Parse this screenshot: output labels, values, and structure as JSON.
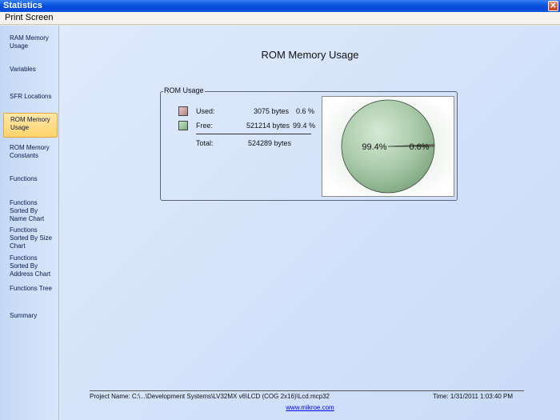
{
  "window": {
    "title": "Statistics"
  },
  "menu": {
    "print_screen": "Print Screen"
  },
  "sidebar": {
    "items": [
      {
        "label": "RAM Memory Usage",
        "active": false
      },
      {
        "label": "Variables",
        "active": false
      },
      {
        "label": "SFR Locations",
        "active": false
      },
      {
        "label": "ROM Memory Usage",
        "active": true
      },
      {
        "label": "ROM Memory Constants",
        "active": false
      },
      {
        "label": "Functions",
        "active": false
      },
      {
        "label": "Functions Sorted By Name Chart",
        "active": false
      },
      {
        "label": "Functions Sorted By Size Chart",
        "active": false
      },
      {
        "label": "Functions Sorted By Address Chart",
        "active": false
      },
      {
        "label": "Functions Tree",
        "active": false
      },
      {
        "label": "Summary",
        "active": false
      }
    ]
  },
  "main": {
    "title": "ROM Memory  Usage",
    "group_label": "ROM Usage",
    "used": {
      "label": "Used:",
      "bytes": "3075 bytes",
      "percent": "0.6 %"
    },
    "free": {
      "label": "Free:",
      "bytes": "521214 bytes",
      "percent": "99.4 %"
    },
    "total": {
      "label": "Total:",
      "bytes": "524289 bytes"
    }
  },
  "chart_data": {
    "type": "pie",
    "slices": [
      {
        "name": "Free",
        "value": 99.4,
        "label": "99.4%",
        "color": "#8fb88f"
      },
      {
        "name": "Used",
        "value": 0.6,
        "label": "0.6%",
        "color": "#a07878"
      }
    ]
  },
  "footer": {
    "project": "Project Name: C:\\...\\Development Systems\\LV32MX v6\\LCD (COG 2x16)\\Lcd.mcp32",
    "time": "Time: 1/31/2011 1:03:40 PM",
    "link": "www.mikroe.com"
  },
  "colors": {
    "titlebar": "#0a58e0",
    "active_item": "#ffd36b"
  }
}
